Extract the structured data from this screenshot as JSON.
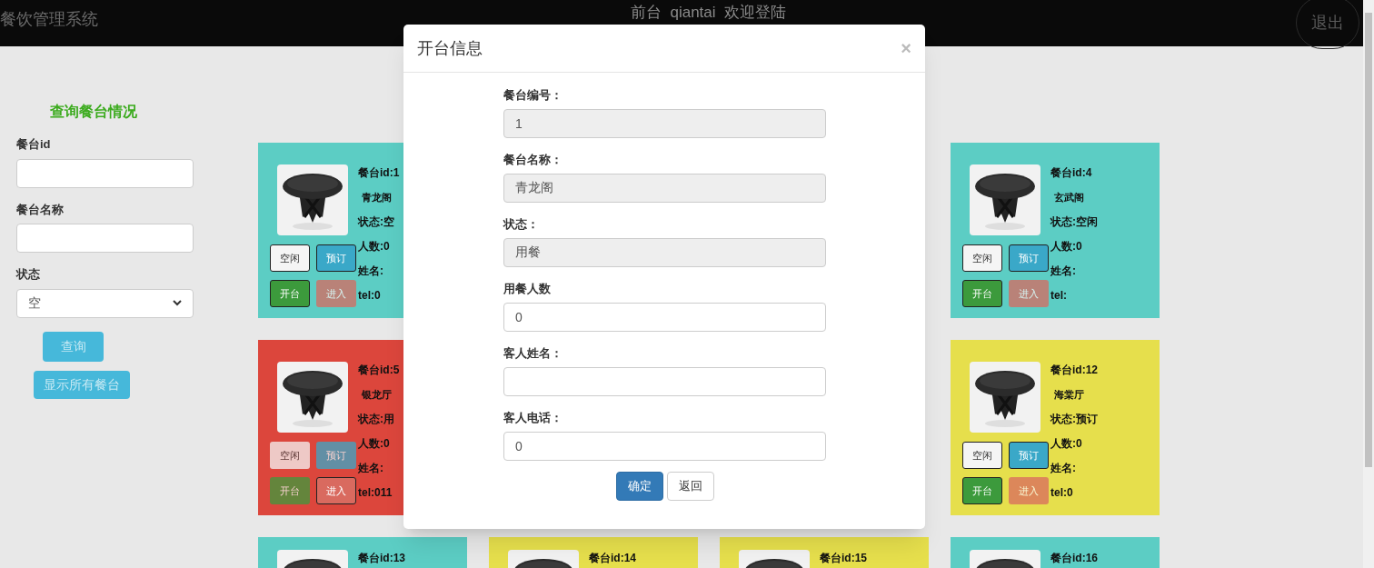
{
  "header": {
    "title": "餐饮管理系统",
    "welcome": "前台  qiantai  欢迎登陆",
    "logout": "退出"
  },
  "sidebar": {
    "title": "查询餐台情况",
    "fields": [
      {
        "label": "餐台id",
        "kind": "text"
      },
      {
        "label": "餐台名称",
        "kind": "text"
      },
      {
        "label": "状态",
        "kind": "select",
        "value": "空"
      }
    ],
    "buttons": [
      "查询",
      "显示所有餐台"
    ]
  },
  "table_rows": [
    [
      {
        "color": "#5ccdc4",
        "lines": [
          "餐台id:1",
          "青龙阁",
          "状态:空",
          "人数:0",
          "姓名:",
          "tel:0"
        ],
        "buttons": [
          {
            "label": "空闲",
            "kind": "free",
            "enabled": true
          },
          {
            "label": "预订",
            "kind": "book",
            "enabled": true
          },
          {
            "label": "开台",
            "kind": "open",
            "enabled": true
          },
          {
            "label": "进入",
            "kind": "enter",
            "enabled": false
          }
        ]
      },
      null,
      null,
      {
        "color": "#5ccdc4",
        "lines": [
          "餐台id:4",
          "玄武阁",
          "状态:空闲",
          "人数:0",
          "姓名:",
          "tel:"
        ],
        "buttons": [
          {
            "label": "空闲",
            "kind": "free",
            "enabled": true
          },
          {
            "label": "预订",
            "kind": "book",
            "enabled": true
          },
          {
            "label": "开台",
            "kind": "open",
            "enabled": true
          },
          {
            "label": "进入",
            "kind": "enter",
            "enabled": false
          }
        ]
      }
    ],
    [
      {
        "color": "#dc463c",
        "lines": [
          "餐台id:5",
          "银龙厅",
          "状态:用",
          "人数:0",
          "姓名:",
          "tel:011"
        ],
        "buttons": [
          {
            "label": "空闲",
            "kind": "free",
            "enabled": false
          },
          {
            "label": "预订",
            "kind": "book",
            "enabled": false
          },
          {
            "label": "开台",
            "kind": "open",
            "enabled": false
          },
          {
            "label": "进入",
            "kind": "enter",
            "enabled": true
          }
        ]
      },
      null,
      null,
      {
        "color": "#e6df4c",
        "lines": [
          "餐台id:12",
          "海棠厅",
          "状态:预订",
          "人数:0",
          "姓名:",
          "tel:0"
        ],
        "buttons": [
          {
            "label": "空闲",
            "kind": "free",
            "enabled": true
          },
          {
            "label": "预订",
            "kind": "book",
            "enabled": true
          },
          {
            "label": "开台",
            "kind": "open",
            "enabled": true
          },
          {
            "label": "进入",
            "kind": "enter",
            "enabled": false
          }
        ]
      }
    ],
    [
      {
        "color": "#5ccdc4",
        "lines": [
          "餐台id:13"
        ]
      },
      {
        "color": "#e6df4c",
        "lines": [
          "餐台id:14"
        ]
      },
      {
        "color": "#e6df4c",
        "lines": [
          "餐台id:15"
        ]
      },
      {
        "color": "#5ccdc4",
        "lines": [
          "餐台id:16"
        ]
      }
    ]
  ],
  "modal": {
    "title": "开台信息",
    "close": "×",
    "fields": [
      {
        "label": "餐台编号：",
        "value": "1",
        "readonly": true
      },
      {
        "label": "餐台名称：",
        "value": "青龙阁",
        "readonly": true
      },
      {
        "label": "状态：",
        "value": "用餐",
        "readonly": true
      },
      {
        "label": "用餐人数",
        "value": "0",
        "readonly": false
      },
      {
        "label": "客人姓名：",
        "readonly": false
      },
      {
        "label": "客人电话：",
        "value": "0",
        "readonly": false
      }
    ],
    "buttons": [
      {
        "label": "确定",
        "kind": "primary"
      },
      {
        "label": "返回",
        "kind": "default"
      }
    ]
  }
}
